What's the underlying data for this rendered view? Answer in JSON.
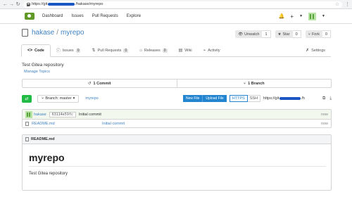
{
  "browser": {
    "url_prefix": "https://git",
    "url_suffix": "/hakase/myrepo"
  },
  "topnav": {
    "items": [
      "Dashboard",
      "Issues",
      "Pull Requests",
      "Explore"
    ],
    "plus": "+",
    "bell": "🔔"
  },
  "repo": {
    "owner": "hakase",
    "name": "myrepo",
    "separator": "/",
    "unwatch_label": "Unwatch",
    "unwatch_count": "1",
    "star_label": "Star",
    "star_count": "0",
    "fork_label": "Fork",
    "fork_count": "0"
  },
  "tabs": [
    {
      "label": "Code",
      "icon": "<>"
    },
    {
      "label": "Issues",
      "count": "0"
    },
    {
      "label": "Pull Requests",
      "count": "0"
    },
    {
      "label": "Releases",
      "count": "0"
    },
    {
      "label": "Wiki"
    },
    {
      "label": "Activity"
    }
  ],
  "settings_label": "Settings",
  "description": "Test Gitea repository",
  "manage_topics": "Manage Topics",
  "stats": {
    "commits": "1 Commit",
    "branches": "1 Branch"
  },
  "branch": {
    "selector": "Branch: master",
    "repo_link": "myrepo",
    "new_file": "New File",
    "upload_file": "Upload File",
    "https": "HTTPS",
    "ssh": "SSH",
    "clone_prefix": "https://git",
    "clone_suffix": "/h"
  },
  "commit": {
    "author": "hakase",
    "sha": "63114e59fc",
    "message": "Initial commit",
    "when": "now"
  },
  "files": [
    {
      "name": "README.md",
      "message": "Initial commit",
      "when": "now"
    }
  ],
  "readme": {
    "filename": "README.md",
    "heading": "myrepo",
    "body": "Test Gitea repository"
  }
}
